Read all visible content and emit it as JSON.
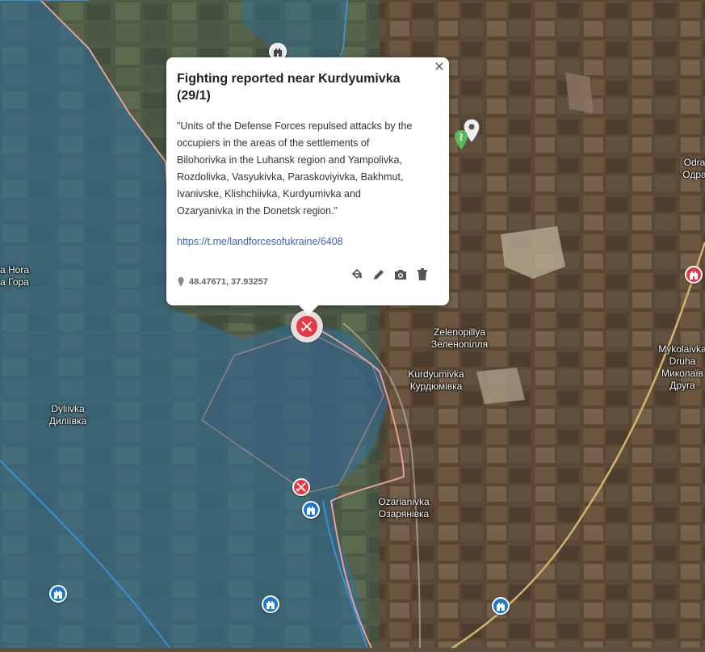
{
  "map": {
    "places": [
      {
        "id": "odra",
        "line1": "Odra",
        "line2": "Одра"
      },
      {
        "id": "nora",
        "line1": "a Hora",
        "line2": "а Гора"
      },
      {
        "id": "zelenopillya",
        "line1": "Zelenopillya",
        "line2": "Зеленопілля"
      },
      {
        "id": "kurdyumivka",
        "line1": "Kurdyumivka",
        "line2": "Курдюмівка"
      },
      {
        "id": "mykolaivka",
        "line1": "Mykolaivka",
        "line2": "Druha",
        "line3": "Миколаїв",
        "line4": "Друга"
      },
      {
        "id": "dyliivka",
        "line1": "Dyliivka",
        "line2": "Диліївка"
      },
      {
        "id": "ozarianivka",
        "line1": "Ozarianivka",
        "line2": "Озарянівка"
      }
    ],
    "colors": {
      "ua_zone_fill": "#2f6f9c",
      "ua_zone_border": "#3b8fd8",
      "contested_border": "#f4a3a3",
      "marker_red": "#e53945",
      "marker_blue": "#1b78d0"
    },
    "markers": [
      {
        "type": "fort-icon",
        "color": "gray"
      },
      {
        "type": "fort-icon",
        "color": "blue"
      },
      {
        "type": "fort-icon",
        "color": "blue"
      },
      {
        "type": "fort-icon",
        "color": "blue"
      },
      {
        "type": "fort-icon",
        "color": "blue"
      },
      {
        "type": "fort-icon",
        "color": "red"
      },
      {
        "type": "battle-icon",
        "color": "red"
      },
      {
        "type": "battle-icon",
        "color": "red",
        "selected": true
      },
      {
        "type": "map-pin-icon",
        "color": "gray"
      },
      {
        "type": "hiker-icon",
        "color": "green"
      }
    ]
  },
  "popup": {
    "title": "Fighting reported near Kurdyumivka (29/1)",
    "body": "\"Units of the Defense Forces repulsed attacks by the occupiers in the areas of the settlements of Bilohorivka in the Luhansk region and Yampolivka, Rozdolivka, Vasyukivka, Paraskoviyivka, Bakhmut, Ivanivske, Klishchiivka, Kurdyumivka and Ozaryanivka in the Donetsk region.\"",
    "link": "https://t.me/landforcesofukraine/6408",
    "coords": "48.47671, 37.93257",
    "tools": [
      "paint-bucket-icon",
      "pencil-icon",
      "camera-icon",
      "trash-icon"
    ]
  }
}
